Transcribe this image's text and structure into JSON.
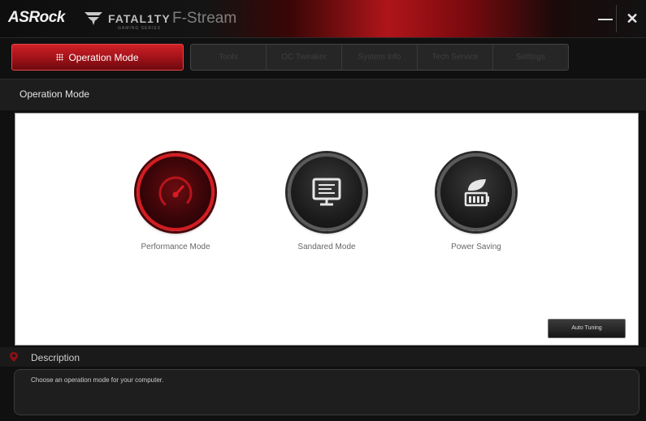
{
  "app": {
    "brand": "ASRock",
    "product": "FATAL1TY",
    "product_sub": "GAMING SERIES",
    "window_title": "F-Stream",
    "minimize_glyph": "—",
    "close_glyph": "✕"
  },
  "nav": {
    "active_tab": "Operation Mode",
    "tabs": [
      "Tools",
      "OC Tweaker",
      "System Info",
      "Tech Service",
      "Settings"
    ]
  },
  "section": {
    "title": "Operation Mode"
  },
  "modes": [
    {
      "label": "Performance Mode",
      "icon": "speedometer-icon",
      "selected": true
    },
    {
      "label": "Sandared Mode",
      "icon": "monitor-icon",
      "selected": false
    },
    {
      "label": "Power Saving",
      "icon": "leaf-battery-icon",
      "selected": false
    }
  ],
  "auto_tuning": {
    "label": "Auto Tuning"
  },
  "description": {
    "title": "Description",
    "text": "Choose an operation mode for your computer."
  },
  "colors": {
    "accent": "#c8161d",
    "background": "#101010",
    "panel": "#ffffff"
  }
}
